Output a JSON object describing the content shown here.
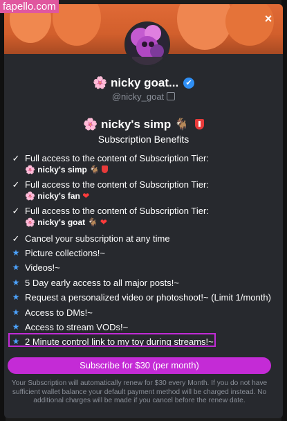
{
  "watermark": "fapello.com",
  "close_label": "×",
  "profile": {
    "name_emoji": "🌸",
    "name": "nicky goat...",
    "verified_icon": "✔",
    "handle": "@nicky_goat"
  },
  "tier": {
    "flower": "🌸",
    "name": "nicky's simp",
    "goat": "🐐"
  },
  "benefits_title": "Subscription Benefits",
  "benefits": [
    {
      "icon": "check",
      "text": "Full access to the content of Subscription Tier:",
      "sub_flower": "🌸",
      "sub_text": "nicky's simp",
      "sub_goat": "🐐",
      "sub_badge": "shield"
    },
    {
      "icon": "check",
      "text": "Full access to the content of Subscription Tier:",
      "sub_flower": "🌸",
      "sub_text": "nicky's fan",
      "sub_heart": "❤"
    },
    {
      "icon": "check",
      "text": "Full access to the content of Subscription Tier:",
      "sub_flower": "🌸",
      "sub_text": "nicky's goat",
      "sub_goat": "🐐",
      "sub_heart": "❤"
    },
    {
      "icon": "check",
      "text": "Cancel your subscription at any time"
    },
    {
      "icon": "star",
      "text": "Picture collections!~"
    },
    {
      "icon": "star",
      "text": "Videos!~"
    },
    {
      "icon": "star",
      "text": "5 Day early access to all major posts!~"
    },
    {
      "icon": "star",
      "text": "Request a personalized video or photoshoot!~ (Limit 1/month)"
    },
    {
      "icon": "star",
      "text": "Access to DMs!~"
    },
    {
      "icon": "star",
      "text": "Access to stream VODs!~"
    },
    {
      "icon": "star",
      "text": "2 Minute control link to my toy during streams!~"
    }
  ],
  "subscribe_button": "Subscribe for $30 (per month)",
  "notice": "Your Subscription will automatically renew for $30 every Month. If you do not have sufficient wallet balance your default payment method will be charged instead. No additional charges will be made if you cancel before the renew date.",
  "colors": {
    "accent": "#c42bd6",
    "banner": "#e06a36",
    "modal_bg": "#27292e",
    "verified": "#2f8ff5",
    "star": "#4ca3ff"
  }
}
